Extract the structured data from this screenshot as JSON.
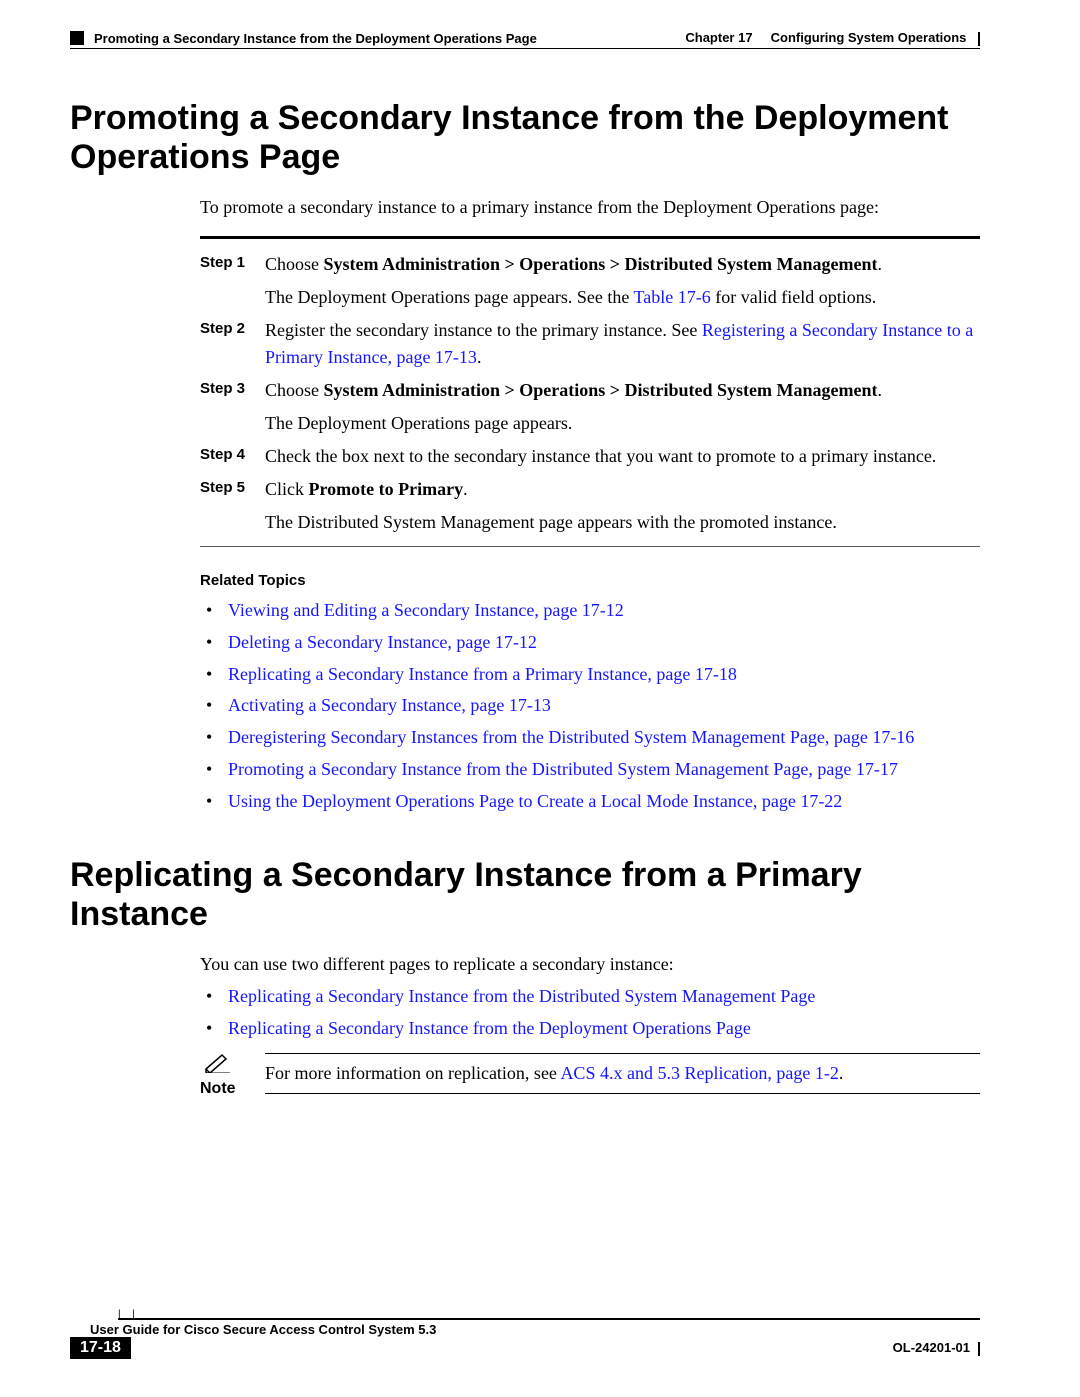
{
  "header": {
    "left": "Promoting a Secondary Instance from the Deployment Operations Page",
    "right_chapter": "Chapter 17",
    "right_title": "Configuring System Operations"
  },
  "section1": {
    "heading": "Promoting a Secondary Instance from the Deployment Operations Page",
    "intro": "To promote a secondary instance to a primary instance from the Deployment Operations page:",
    "steps": [
      {
        "label": "Step 1",
        "prefix": "Choose ",
        "bold": "System Administration > Operations > Distributed System Management",
        "suffix": ".",
        "sub_pre": "The Deployment Operations page appears. See the ",
        "sub_link": "Table 17-6",
        "sub_post": " for valid field options."
      },
      {
        "label": "Step 2",
        "prefix": "Register the secondary instance to the primary instance. See ",
        "link": "Registering a Secondary Instance to a Primary Instance, page 17-13",
        "suffix": "."
      },
      {
        "label": "Step 3",
        "prefix": "Choose ",
        "bold": "System Administration > Operations > Distributed System Management",
        "suffix": ".",
        "sub_plain": "The Deployment Operations page appears."
      },
      {
        "label": "Step 4",
        "plain": "Check the box next to the secondary instance that you want to promote to a primary instance."
      },
      {
        "label": "Step 5",
        "prefix": "Click ",
        "bold": "Promote to Primary",
        "suffix": ".",
        "sub_plain": "The Distributed System Management page appears with the promoted instance."
      }
    ],
    "related_heading": "Related Topics",
    "related": [
      "Viewing and Editing a Secondary Instance, page 17-12",
      "Deleting a Secondary Instance, page 17-12",
      "Replicating a Secondary Instance from a Primary Instance, page 17-18",
      "Activating a Secondary Instance, page 17-13",
      "Deregistering Secondary Instances from the Distributed System Management Page, page 17-16",
      "Promoting a Secondary Instance from the Distributed System Management Page, page 17-17",
      "Using the Deployment Operations Page to Create a Local Mode Instance, page 17-22"
    ]
  },
  "section2": {
    "heading": "Replicating a Secondary Instance from a Primary Instance",
    "intro": "You can use two different pages to replicate a secondary instance:",
    "links": [
      "Replicating a Secondary Instance from the Distributed System Management Page",
      "Replicating a Secondary Instance from the Deployment Operations Page"
    ],
    "note_label": "Note",
    "note_pre": "For more information on replication, see ",
    "note_link": "ACS 4.x and 5.3 Replication, page 1-2",
    "note_post": "."
  },
  "footer": {
    "guide": "User Guide for Cisco Secure Access Control System 5.3",
    "page": "17-18",
    "ol": "OL-24201-01"
  }
}
